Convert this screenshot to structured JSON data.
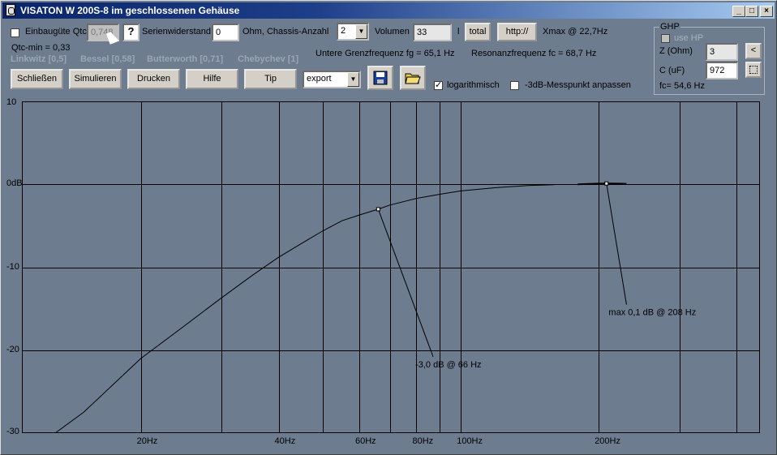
{
  "window": {
    "title": "VISATON W 200S-8 im geschlossenen Gehäuse"
  },
  "controls": {
    "qtc_checkbox_label": "Einbaugüte Qtc",
    "qtc_value": "0,748",
    "help_button": "?",
    "serien_label": "Serienwiderstand",
    "serien_value": "0",
    "ohm_chassis_label": "Ohm, Chassis-Anzahl",
    "chassis_value": "2",
    "volumen_label": "Volumen",
    "volumen_value": "33",
    "liter_label": "l",
    "total_button": "total",
    "http_button": "http://",
    "xmax_text": "Xmax @ 22,7Hz",
    "qtc_min_text": "Qtc-min = 0,33",
    "presets": [
      "Linkwitz [0,5]",
      "Bessel [0,58]",
      "Butterworth [0,71]",
      "Chebychev [1]"
    ],
    "grenzfrequenz_text": "Untere Grenzfrequenz fg = 65,1 Hz",
    "resonanz_text": "Resonanzfrequenz fc = 68,7 Hz",
    "buttons": {
      "close": "Schließen",
      "simulate": "Simulieren",
      "print": "Drucken",
      "help": "Hilfe",
      "tip": "Tip"
    },
    "export_value": "export",
    "log_label": "logarithmisch",
    "log_checked": true,
    "messpunkt_label": "-3dB-Messpunkt anpassen",
    "messpunkt_checked": false
  },
  "ghp": {
    "group_title": "GHP",
    "use_hp_label": "use HP",
    "z_label": "Z (Ohm)",
    "z_value": "3",
    "c_label": "C (uF)",
    "c_value": "972",
    "fc_text": "fc= 54,6 Hz",
    "arrow_button": "<"
  },
  "chart_data": {
    "type": "line",
    "x_scale": "log",
    "xlim": [
      11,
      450
    ],
    "ylim": [
      -30,
      10
    ],
    "y_ticks": [
      10,
      0,
      -10,
      -20,
      -30
    ],
    "y_tick_labels": [
      "10",
      "0dB",
      "-10",
      "-20",
      "-30"
    ],
    "x_ticks": [
      20,
      40,
      60,
      80,
      100,
      200
    ],
    "x_tick_labels": [
      "20Hz",
      "40Hz",
      "60Hz",
      "80Hz",
      "100Hz",
      "200Hz"
    ],
    "x_grid": [
      20,
      30,
      40,
      50,
      60,
      70,
      80,
      90,
      100,
      200,
      300,
      400
    ],
    "series": [
      {
        "x": [
          13,
          15,
          20,
          25,
          30,
          35,
          40,
          45,
          50,
          55,
          60,
          66,
          70,
          80,
          90,
          100,
          120,
          140,
          160
        ],
        "y": [
          -30,
          -27.5,
          -21,
          -17,
          -13.7,
          -11,
          -8.8,
          -7.1,
          -5.6,
          -4.4,
          -3.7,
          -3.0,
          -2.5,
          -1.7,
          -1.2,
          -0.8,
          -0.4,
          -0.15,
          -0.05
        ]
      },
      {
        "x": [
          180,
          190,
          200,
          208,
          220,
          230
        ],
        "y": [
          0.0,
          0.05,
          0.08,
          0.1,
          0.08,
          0.06
        ]
      }
    ],
    "annotations": [
      {
        "text": "-3,0 dB @ 66 Hz",
        "x": 66,
        "y": -3.0,
        "label_x": 87,
        "label_y": -20.8
      },
      {
        "text": "max 0,1 dB @ 208 Hz",
        "x": 208,
        "y": 0.1,
        "label_x": 230,
        "label_y": -14.5
      }
    ],
    "line_color": "#000000",
    "background": "#6d7c8f"
  }
}
